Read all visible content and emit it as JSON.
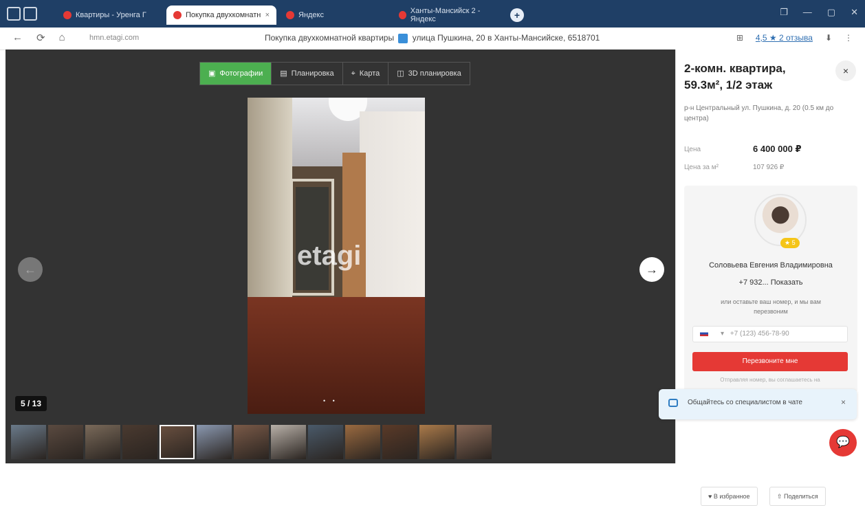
{
  "browser": {
    "tabs": [
      {
        "label": "Квартиры - Уренга Г",
        "active": false,
        "favicon_color": "#e53935"
      },
      {
        "label": "Покупка двухкомнатн",
        "active": true,
        "favicon_color": "#e53935"
      },
      {
        "label": "Яндекс",
        "active": false,
        "favicon_color": "#e53935"
      },
      {
        "label": "Ханты-Мансийск 2 - Яндекс",
        "active": false,
        "favicon_color": "#e53935"
      }
    ],
    "tab_close": "×",
    "new_tab": "+",
    "window_controls": [
      "❐",
      "—",
      "▢",
      "✕"
    ]
  },
  "addressbar": {
    "nav": [
      "←",
      "⟳",
      "⌂"
    ],
    "host": "hmn.etagi.com",
    "page_title_prefix": "Покупка двухкомнатной квартиры",
    "page_title_suffix": "улица Пушкина, 20 в Ханты-Мансийске, 6518701",
    "rating_text": "4,5 ★ 2 отзыва",
    "right_icons": [
      "⊞",
      "⬇",
      "⋮"
    ]
  },
  "gallery": {
    "tabs": [
      {
        "icon": "▣",
        "label": "Фотографии",
        "active": true
      },
      {
        "icon": "▤",
        "label": "Планировка",
        "active": false
      },
      {
        "icon": "⌖",
        "label": "Карта",
        "active": false
      },
      {
        "icon": "◫",
        "label": "3D планировка",
        "active": false
      }
    ],
    "watermark": "etagi",
    "photo_counter": "5 / 13",
    "prev_arrow": "←",
    "next_arrow": "→",
    "photo_nav_dots": "• •",
    "thumbnails": [
      {
        "color": "#6a7a8a",
        "selected": false
      },
      {
        "color": "#5a4a40",
        "selected": false
      },
      {
        "color": "#7a6a5a",
        "selected": false
      },
      {
        "color": "#4a3a30",
        "selected": false
      },
      {
        "color": "#6a5040",
        "selected": true
      },
      {
        "color": "#8a98b0",
        "selected": false
      },
      {
        "color": "#7a5a48",
        "selected": false
      },
      {
        "color": "#b8b0a8",
        "selected": false
      },
      {
        "color": "#4a5a6a",
        "selected": false
      },
      {
        "color": "#9a6a40",
        "selected": false
      },
      {
        "color": "#5a3a28",
        "selected": false
      },
      {
        "color": "#aa7a4a",
        "selected": false
      },
      {
        "color": "#8a6a58",
        "selected": false
      }
    ]
  },
  "listing": {
    "title": "2-комн. квартира, 59.3м², 1/2 этаж",
    "close": "×",
    "address": "р-н Центральный ул. Пушкина, д. 20 (0.5 км до центра)",
    "price_label": "Цена",
    "price": "6 400 000 ₽",
    "price_per_m_label": "Цена за м²",
    "price_per_m": "107 926 ₽"
  },
  "agent": {
    "rating": "★ 5",
    "name": "Соловьева Евгения Владимировна",
    "phone": "+7 932... Показать",
    "hint": "или оставьте ваш номер, и мы вам перезвоним",
    "phone_placeholder": "+7 (123) 456-78-90",
    "phone_country_arrow": "▾",
    "call_button": "Перезвоните мне",
    "tiny_note": "Отправляя номер, вы соглашаетесь на"
  },
  "chat_popup": {
    "text": "Общайтесь со специалистом в чате",
    "close": "×"
  },
  "bottom_actions": {
    "favorite": "♥ В избранное",
    "share": "⇧ Поделиться",
    "fab": "💬"
  }
}
